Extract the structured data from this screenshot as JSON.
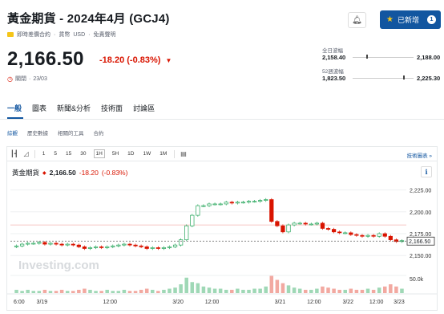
{
  "header": {
    "title": "黃金期貨 - 2024年4月 (GCJ4)",
    "contract_type": "即時差價合約",
    "currency_label": "貨幣",
    "currency": "USD",
    "disclaimer": "免責聲明",
    "add_watchlist_label": "已新增",
    "watchlist_count": "1"
  },
  "quote": {
    "price": "2,166.50",
    "change": "-18.20",
    "change_pct": "(-0.83%)",
    "status": "關閉",
    "date": "23/03"
  },
  "ranges": {
    "day_label": "全日波幅",
    "day_low": "2,158.40",
    "day_high": "2,188.00",
    "week52_label": "52週波幅",
    "week52_low": "1,823.50",
    "week52_high": "2,225.30"
  },
  "tabs": [
    "一般",
    "圖表",
    "新聞&分析",
    "技術面",
    "討論區"
  ],
  "subtabs": [
    "綜觀",
    "歷史數據",
    "相關的工具",
    "合約"
  ],
  "toolbar": {
    "intervals": [
      "1",
      "5",
      "15",
      "30",
      "1H",
      "5H",
      "1D",
      "1W",
      "1M"
    ],
    "selected_interval": "1H",
    "tech_chart_link": "技術圖表 »"
  },
  "chart_label": {
    "name": "黃金期貨",
    "price": "2,166.50",
    "change": "-18.20",
    "change_pct": "(-0.83%)"
  },
  "chart_data": {
    "type": "candlestick",
    "y_ticks": [
      "2,225.00",
      "2,200.00",
      "2,175.00",
      "2,150.00"
    ],
    "y_range": [
      2141,
      2231
    ],
    "current_price_tag": "2,166.50",
    "volume_tick": "50.0k",
    "x_ticks": [
      "6:00",
      "3/19",
      "12:00",
      "3/20",
      "12:00",
      "3/21",
      "12:00",
      "3/22",
      "12:00",
      "3/23"
    ],
    "watermark": "Investing.com",
    "reference_level": 2185,
    "closes": [
      2161,
      2163,
      2164,
      2164,
      2165,
      2163,
      2164,
      2163,
      2162,
      2163,
      2162,
      2160,
      2158,
      2159,
      2160,
      2159,
      2160,
      2161,
      2162,
      2163,
      2162,
      2161,
      2160,
      2158,
      2159,
      2158,
      2159,
      2160,
      2162,
      2168,
      2184,
      2196,
      2207,
      2207,
      2209,
      2209,
      2209,
      2211,
      2210,
      2211,
      2211,
      2212,
      2212,
      2213,
      2214,
      2189,
      2184,
      2177,
      2185,
      2187,
      2187,
      2186,
      2186,
      2187,
      2181,
      2180,
      2177,
      2176,
      2176,
      2174,
      2173,
      2172,
      2173,
      2172,
      2175,
      2172,
      2168,
      2166,
      2167
    ],
    "volumes": [
      3,
      2,
      3,
      2,
      2,
      3,
      2,
      2,
      3,
      2,
      2,
      3,
      4,
      3,
      2,
      2,
      3,
      2,
      2,
      3,
      2,
      2,
      3,
      4,
      3,
      2,
      3,
      4,
      5,
      8,
      14,
      10,
      9,
      6,
      5,
      4,
      4,
      3,
      3,
      4,
      3,
      3,
      4,
      4,
      6,
      16,
      12,
      9,
      7,
      5,
      4,
      3,
      3,
      4,
      6,
      5,
      4,
      3,
      3,
      4,
      3,
      3,
      4,
      3,
      5,
      6,
      8,
      6,
      4
    ]
  },
  "colors": {
    "up": "#26a65b",
    "down": "#d91400",
    "accent": "#1256a0"
  }
}
